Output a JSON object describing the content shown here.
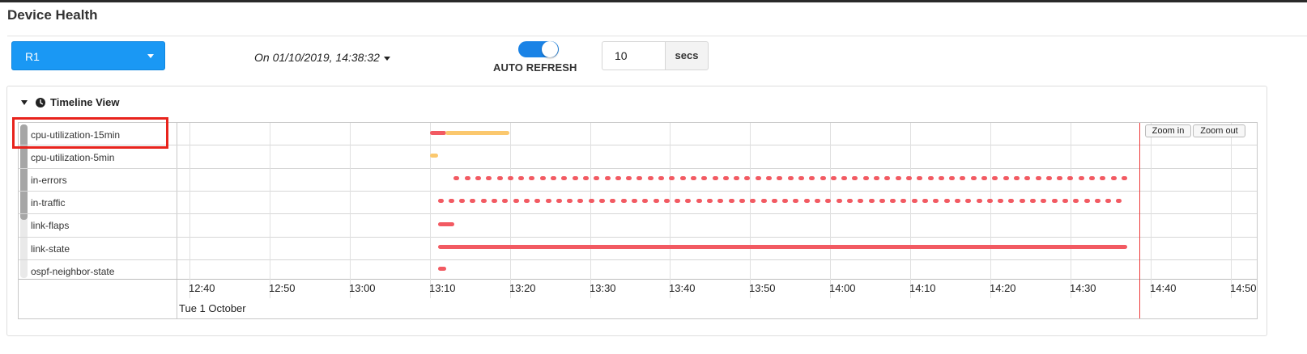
{
  "page": {
    "title": "Device Health"
  },
  "toolbar": {
    "device_selected": "R1",
    "date_display": "On 01/10/2019, 14:38:32",
    "auto_refresh_label": "AUTO REFRESH",
    "auto_refresh_on": true,
    "interval_value": "10",
    "interval_unit": "secs"
  },
  "panel": {
    "title": "Timeline View"
  },
  "timeline": {
    "rows": [
      "cpu-utilization-15min",
      "cpu-utilization-5min",
      "in-errors",
      "in-traffic",
      "link-flaps",
      "link-state",
      "ospf-neighbor-state"
    ],
    "ticks": [
      "12:40",
      "12:50",
      "13:00",
      "13:10",
      "13:20",
      "13:30",
      "13:40",
      "13:50",
      "14:00",
      "14:10",
      "14:20",
      "14:30",
      "14:40",
      "14:50"
    ],
    "date_label": "Tue 1 October",
    "zoom_in_label": "Zoom in",
    "zoom_out_label": "Zoom out",
    "now_marker": "14:38:32",
    "events": [
      {
        "row": "cpu-utilization-15min",
        "start": "13:10",
        "end": "13:12",
        "color": "#f25a62",
        "style": "solid"
      },
      {
        "row": "cpu-utilization-15min",
        "start": "13:12",
        "end": "13:20",
        "color": "#fbc86e",
        "style": "solid"
      },
      {
        "row": "cpu-utilization-5min",
        "start": "13:10",
        "end": "13:11",
        "color": "#fbc86e",
        "style": "solid"
      },
      {
        "row": "in-errors",
        "start": "13:13",
        "end": "14:37",
        "color": "#f25a62",
        "style": "dashed"
      },
      {
        "row": "in-traffic",
        "start": "13:11",
        "end": "14:37",
        "color": "#f25a62",
        "style": "dashed"
      },
      {
        "row": "link-flaps",
        "start": "13:11",
        "end": "13:13",
        "color": "#f25a62",
        "style": "solid"
      },
      {
        "row": "link-state",
        "start": "13:11",
        "end": "14:37",
        "color": "#f25a62",
        "style": "solid"
      },
      {
        "row": "ospf-neighbor-state",
        "start": "13:11",
        "end": "13:12",
        "color": "#f25a62",
        "style": "solid"
      }
    ],
    "highlighted_row": "cpu-utilization-15min"
  },
  "colors": {
    "accent": "#1a98f4",
    "alert": "#f25a62",
    "warning": "#fbc86e",
    "now_marker": "#ee3a3a",
    "highlight": "#e8231c"
  },
  "icons": {
    "collapse": "triangle-down-icon",
    "clock": "clock-icon",
    "dropdown": "caret-down-icon"
  }
}
